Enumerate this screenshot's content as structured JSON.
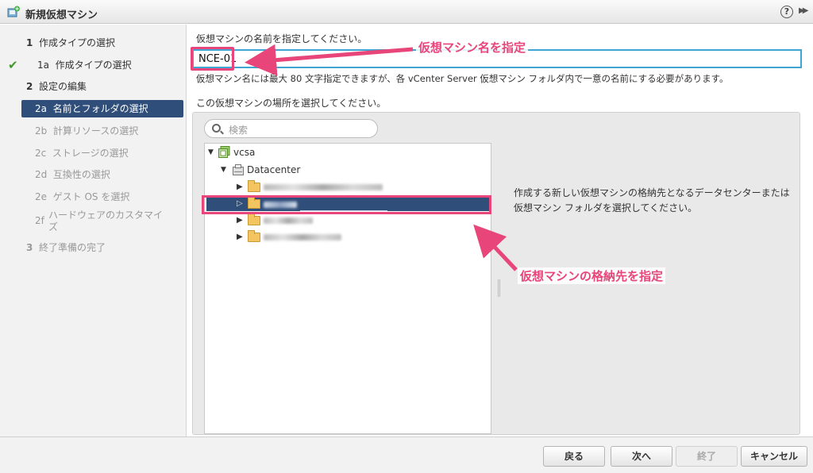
{
  "window": {
    "title": "新規仮想マシン",
    "help_label": "?",
    "expand_label": "▶▶"
  },
  "steps": [
    {
      "num": "1",
      "label": "作成タイプの選択",
      "state": "done"
    },
    {
      "num": "1a",
      "label": "作成タイプの選択",
      "state": "done",
      "checked": true
    },
    {
      "num": "2",
      "label": "設定の編集",
      "state": "done"
    },
    {
      "num": "2a",
      "label": "名前とフォルダの選択",
      "state": "active"
    },
    {
      "num": "2b",
      "label": "計算リソースの選択",
      "state": "future"
    },
    {
      "num": "2c",
      "label": "ストレージの選択",
      "state": "future"
    },
    {
      "num": "2d",
      "label": "互換性の選択",
      "state": "future"
    },
    {
      "num": "2e",
      "label": "ゲスト OS を選択",
      "state": "future"
    },
    {
      "num": "2f",
      "label": "ハードウェアのカスタマイ\nズ",
      "state": "future"
    },
    {
      "num": "3",
      "label": "終了準備の完了",
      "state": "future"
    }
  ],
  "main": {
    "name_prompt": "仮想マシンの名前を指定してください。",
    "name_value": "NCE-01",
    "name_hint": "仮想マシン名には最大 80 文字指定できますが、各 vCenter Server 仮想マシン フォルダ内で一意の名前にする必要があります。",
    "location_prompt": "この仮想マシンの場所を選択してください。",
    "search_placeholder": "検索",
    "description": "作成する新しい仮想マシンの格納先となるデータセンターまたは仮想マシン フォルダを選択してください。"
  },
  "tree": {
    "root": "vcsa",
    "datacenter": "Datacenter",
    "folders_count_note": null
  },
  "annotations": {
    "name_callout": "仮想マシン名を指定",
    "folder_callout": "仮想マシンの格納先を指定",
    "accent_color": "#e8457a"
  },
  "footer": {
    "back": "戻る",
    "next": "次へ",
    "finish": "終了",
    "cancel": "キャンセル"
  },
  "colors": {
    "selection": "#2f4e79",
    "input_border": "#3fa5d3",
    "check": "#3c9a28"
  }
}
